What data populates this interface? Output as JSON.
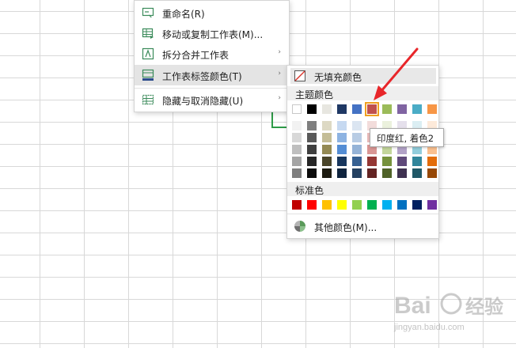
{
  "context_menu": {
    "items": [
      {
        "label": "重命名(R)",
        "icon": "rename-icon",
        "submenu": false
      },
      {
        "label": "移动或复制工作表(M)...",
        "icon": "move-copy-sheet-icon",
        "submenu": false
      },
      {
        "label": "拆分合并工作表",
        "icon": "split-merge-icon",
        "submenu": true
      },
      {
        "label": "工作表标签颜色(T)",
        "icon": "tab-color-icon",
        "submenu": true,
        "active": true
      },
      {
        "label": "隐藏与取消隐藏(U)",
        "icon": "hide-unhide-icon",
        "submenu": true
      }
    ],
    "submenu_arrow": "›"
  },
  "color_panel": {
    "no_fill_label": "无填充颜色",
    "theme_section_label": "主题颜色",
    "standard_section_label": "标准色",
    "more_colors_label": "其他颜色(M)...",
    "theme_base_row": [
      "#ffffff",
      "#000000",
      "#e7e6e0",
      "#1f3864",
      "#4472c4",
      "#c0504d",
      "#9bbb59",
      "#8064a2",
      "#4bacc6",
      "#f79646"
    ],
    "theme_tint_rows": [
      [
        "#f2f2f2",
        "#7f7f7f",
        "#ddd9c4",
        "#c6d9f1",
        "#dbe5f1",
        "#f2dcdb",
        "#ebf1dd",
        "#e5e0ec",
        "#dbeef3",
        "#fdeada"
      ],
      [
        "#d8d8d8",
        "#595959",
        "#c4bd97",
        "#8db3e2",
        "#b8cce4",
        "#e6b9b8",
        "#d7e3bc",
        "#ccc1d9",
        "#b7dde8",
        "#fbd5b5"
      ],
      [
        "#bfbfbf",
        "#3f3f3f",
        "#948a54",
        "#548dd4",
        "#95b3d7",
        "#d99694",
        "#c3d69b",
        "#b2a2c7",
        "#92cddc",
        "#fac08f"
      ],
      [
        "#a5a5a5",
        "#262626",
        "#4a452a",
        "#17365d",
        "#366092",
        "#953734",
        "#76923c",
        "#5f497a",
        "#31859b",
        "#e36c09"
      ],
      [
        "#7f7f7f",
        "#0c0c0c",
        "#1d1b10",
        "#0f243e",
        "#244061",
        "#632423",
        "#4f6228",
        "#3f3151",
        "#205867",
        "#974806"
      ]
    ],
    "standard_colors": [
      "#c00000",
      "#ff0000",
      "#ffc000",
      "#ffff00",
      "#92d050",
      "#00b050",
      "#00b0f0",
      "#0070c0",
      "#002060",
      "#7030a0"
    ],
    "selected_color": "#c0504d",
    "tooltip": "印度红, 着色2"
  },
  "annotation": {
    "arrow_color": "#e8262a"
  },
  "watermark": {
    "logo_text": "Bai度经验",
    "url": "jingyan.baidu.com"
  }
}
